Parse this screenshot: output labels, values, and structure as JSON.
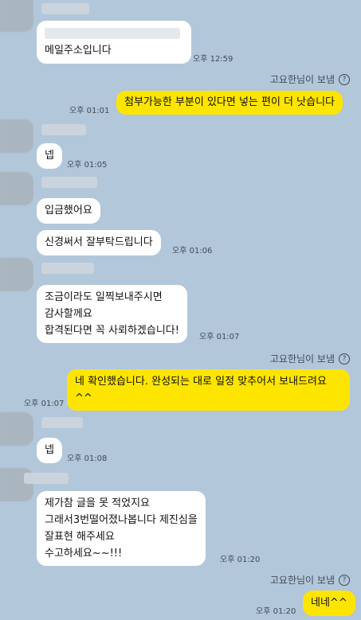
{
  "chat": {
    "blurred_preview": "",
    "messages": [
      {
        "id": "m1",
        "side": "in",
        "lines": [
          "메일주소입니다"
        ],
        "time": "오후 12:59"
      },
      {
        "id": "m2",
        "side": "out",
        "sender": "고요한님이 보냄",
        "lines": [
          "첨부가능한 부분이 있다면 넣는 편이 더 낫습니다"
        ],
        "time": "오후 01:01"
      },
      {
        "id": "m3",
        "side": "in",
        "lines": [
          "넵"
        ],
        "time": "오후 01:05"
      },
      {
        "id": "m4",
        "side": "in",
        "lines": [
          "입금했어요"
        ]
      },
      {
        "id": "m5",
        "side": "in",
        "lines": [
          "신경써서 잘부탁드립니다"
        ],
        "time": "오후 01:06"
      },
      {
        "id": "m6",
        "side": "in",
        "lines": [
          "조금이라도 일찍보내주시면",
          "감사할께요",
          "합격된다면 꼭 사뢰하겠습니다!"
        ],
        "time": "오후 01:07"
      },
      {
        "id": "m7",
        "side": "out",
        "sender": "고요한님이 보냄",
        "lines": [
          "네 확인했습니다. 완성되는 대로 일정 맞추어서 보내드려요",
          "^^"
        ],
        "time": "오후 01:07"
      },
      {
        "id": "m8",
        "side": "in",
        "lines": [
          "넵"
        ],
        "time": "오후 01:08"
      },
      {
        "id": "m9",
        "side": "in",
        "lines": [
          "제가참 글을 못 적었지요",
          "그래서3번떨어졌나봅니다 제진심을",
          "잘표현 해주세요",
          "수고하세요~~!!!"
        ],
        "time": "오후 01:20"
      },
      {
        "id": "m10",
        "side": "out",
        "sender": "고요한님이 보냄",
        "lines": [
          "네네^^"
        ],
        "time": "오후 01:20"
      }
    ]
  },
  "icons": {
    "help": "question-circle-icon",
    "help_glyph": "?"
  },
  "colors": {
    "background": "#b2c7da",
    "outgoing_bubble": "#fee500",
    "incoming_bubble": "#ffffff"
  }
}
